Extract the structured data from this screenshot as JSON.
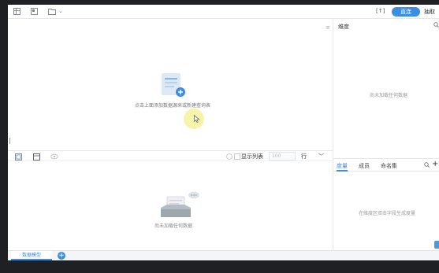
{
  "toolbar": {
    "icons": [
      "grid-view-icon",
      "layout-icon",
      "folder-icon",
      "chevron-down-icon"
    ],
    "caret": "⌄",
    "bracket_label": "[↑]",
    "active_button": "直连",
    "extract_button": "抽取"
  },
  "canvas": {
    "hint": "点击上面添加数据源来或新建查询表"
  },
  "midbar": {
    "icons": [
      "table-view-icon",
      "preview-window-icon",
      "eye-icon",
      "clock-icon",
      "refresh-icon"
    ],
    "show_rows_label": "显示列表",
    "rows_placeholder": "100",
    "rows_unit": "行",
    "collapse": "﹀"
  },
  "preview": {
    "empty_hint": "尚未加载任何数据"
  },
  "dimension_panel": {
    "title": "维度",
    "empty_hint": "尚未加载任何数据"
  },
  "measure_panel": {
    "tabs": [
      "度量",
      "成员",
      "命名集"
    ],
    "active_tab": 0,
    "empty_hint": "在维度区双击字段生成度量",
    "plus": "+"
  },
  "bottom_tabs": {
    "sheet_label": "数据模型",
    "add": "+"
  },
  "colors": {
    "accent": "#3d8ee0",
    "cursor_highlight": "#f4f29a"
  }
}
